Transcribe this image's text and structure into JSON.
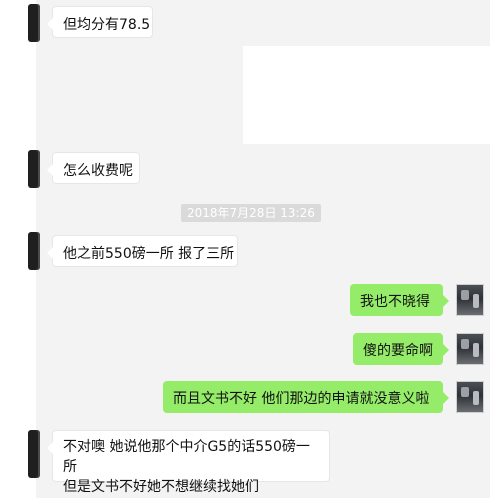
{
  "messages": {
    "m1": "但均分有78.5",
    "m2": "怎么收费呢",
    "timestamp": "2018年7月28日 13:26",
    "m3": "他之前550磅一所 报了三所",
    "m4": "我也不晓得",
    "m5": "傻的要命啊",
    "m6": "而且文书不好 他们那边的申请就没意义啦",
    "m7_line1": "不对噢 她说他那个中介G5的话550磅一所",
    "m7_line2": "但是文书不好她不想继续找她们"
  },
  "colors": {
    "panel_bg": "#f3f3f3",
    "incoming_bubble": "#ffffff",
    "outgoing_bubble": "#95ec69",
    "timestamp_bg": "#dadada",
    "text": "#111111"
  }
}
